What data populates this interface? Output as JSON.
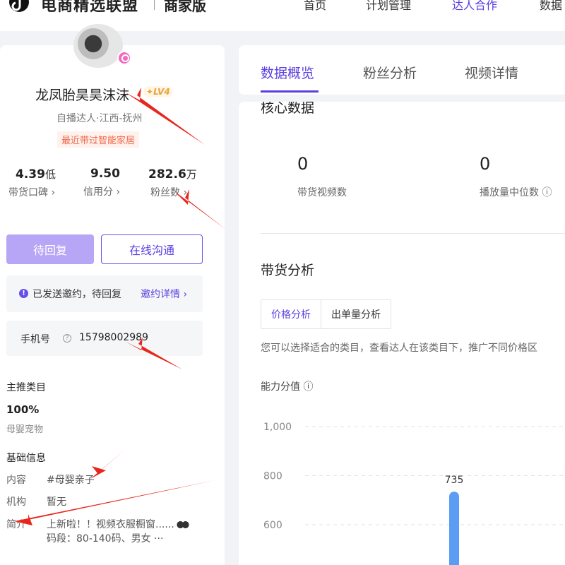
{
  "header": {
    "brand": "电商精选联盟",
    "sub": "商家版",
    "nav": [
      "首页",
      "计划管理",
      "达人合作",
      "数据"
    ]
  },
  "profile": {
    "name": "龙凤胎昊昊沫沫",
    "level": "LV4",
    "role": "自播达人·江西-抚州",
    "recent_tag": "最近带过智能家居",
    "stats": [
      {
        "value": "4.39",
        "unit": "低",
        "label": "带货口碑 ›"
      },
      {
        "value": "9.50",
        "unit": "",
        "label": "信用分 ›"
      },
      {
        "value": "282.6",
        "unit": "万",
        "label": "粉丝数 ›"
      }
    ],
    "btn_wait": "待回复",
    "btn_chat": "在线沟通",
    "invite_text": "已发送邀约，待回复",
    "invite_link": "邀约详情 ›",
    "phone_label": "手机号",
    "phone": "15798002989",
    "main_category_title": "主推类目",
    "main_category_pct": "100%",
    "main_category": "母婴宠物",
    "basic_title": "基础信息",
    "basic": [
      {
        "key": "内容",
        "value": "#母婴亲子"
      },
      {
        "key": "机构",
        "value": "暂无"
      },
      {
        "key": "简介",
        "value": "上新啦！！视频衣服橱窗......",
        "value2": "码段：80-140码、男女 ···"
      }
    ]
  },
  "tabs": [
    "数据概览",
    "粉丝分析",
    "视频详情"
  ],
  "core": {
    "title": "核心数据",
    "metrics": [
      {
        "value": "0",
        "label": "带货视频数"
      },
      {
        "value": "0",
        "label": "播放量中位数 ⓘ"
      }
    ]
  },
  "sales": {
    "title": "带货分析",
    "subtabs": [
      "价格分析",
      "出单量分析"
    ],
    "desc": "您可以选择适合的类目，查看达人在该类目下，推广不同价格区",
    "ability": "能力分值 ⓘ"
  },
  "chart_data": {
    "type": "bar",
    "ylabel": "能力分值",
    "y_ticks": [
      "1,000",
      "800",
      "600"
    ],
    "values": [
      735
    ],
    "ylim": [
      400,
      1000
    ],
    "bar_color": "#5b9cf4"
  },
  "colors": {
    "accent": "#5b3fe0",
    "arrow": "#e8261e"
  }
}
